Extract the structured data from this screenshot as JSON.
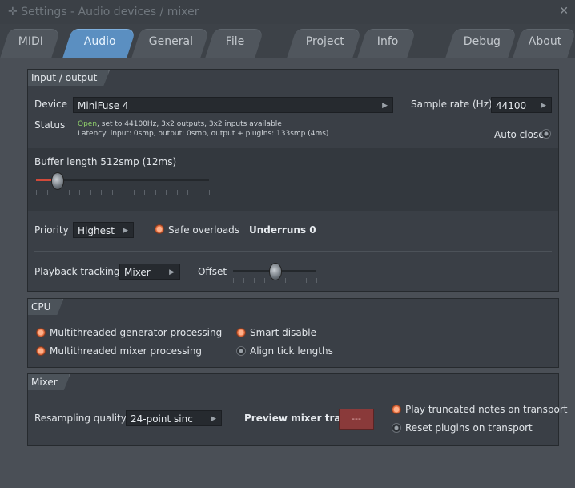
{
  "window": {
    "title": "Settings - Audio devices / mixer"
  },
  "tabs": [
    "MIDI",
    "Audio",
    "General",
    "File",
    "Project",
    "Info",
    "Debug",
    "About"
  ],
  "active_tab": "Audio",
  "io": {
    "title": "Input / output",
    "device_label": "Device",
    "device_value": "MiniFuse 4",
    "sample_rate_label": "Sample rate (Hz)",
    "sample_rate_value": "44100",
    "status_label": "Status",
    "status_open": "Open",
    "status_line1": ", set to 44100Hz, 3x2 outputs, 3x2 inputs available",
    "status_line2": "Latency: input: 0smp, output: 0smp, output + plugins: 133smp (4ms)",
    "auto_close": "Auto close",
    "buffer_label": "Buffer length 512smp (12ms)",
    "buffer_level": 0.12,
    "priority_label": "Priority",
    "priority_value": "Highest",
    "safe_overloads": "Safe overloads",
    "underruns": "Underruns 0",
    "playback_tracking_label": "Playback tracking",
    "playback_tracking_value": "Mixer",
    "offset_label": "Offset",
    "offset_level": 0.5
  },
  "cpu": {
    "title": "CPU",
    "multi_gen": "Multithreaded generator processing",
    "multi_mixer": "Multithreaded mixer processing",
    "smart_disable": "Smart disable",
    "align_tick": "Align tick lengths"
  },
  "mixer": {
    "title": "Mixer",
    "resampling_label": "Resampling quality",
    "resampling_value": "24-point sinc",
    "preview_label": "Preview mixer track",
    "preview_value": "---",
    "play_truncated": "Play truncated notes on transport",
    "reset_plugins": "Reset plugins on transport"
  },
  "icons": {
    "title": "plus-icon",
    "close": "close-icon"
  }
}
